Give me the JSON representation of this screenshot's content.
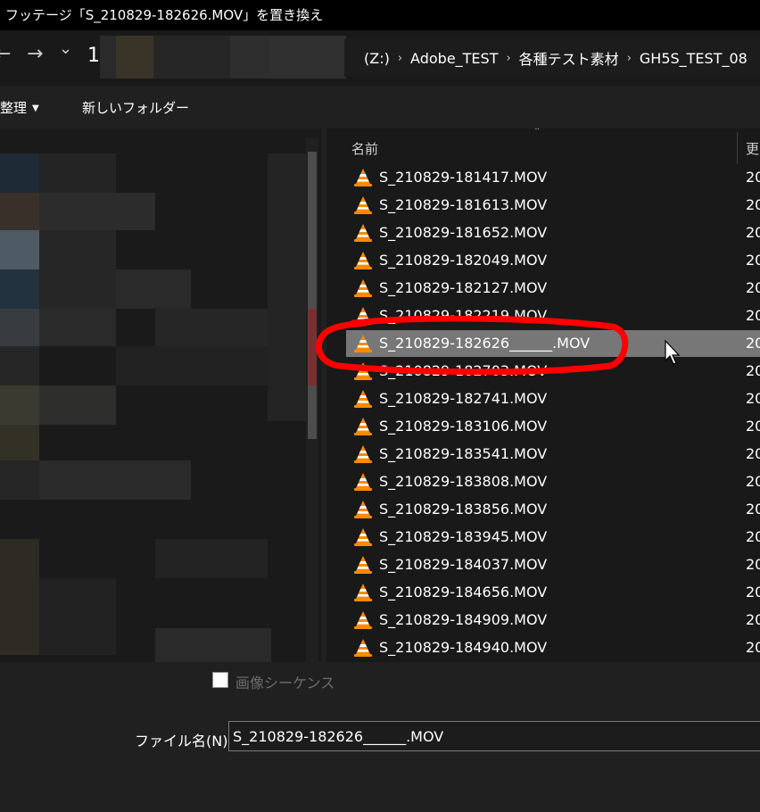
{
  "window": {
    "title": "フッテージ「S_210829-182626.MOV」を置き換え"
  },
  "nav": {
    "back_glyph": "←",
    "forward_glyph": "→",
    "dropdown_glyph": "⌄",
    "partial_text": "1"
  },
  "address": {
    "crumbs": [
      "(Z:)",
      "Adobe_TEST",
      "各種テスト素材",
      "GH5S_TEST_08"
    ],
    "separator": "›"
  },
  "toolbar": {
    "organize_label": "整理",
    "new_folder_label": "新しいフォルダー"
  },
  "file_list": {
    "name_header": "名前",
    "date_header": "更",
    "files": [
      {
        "name": "S_210829-181417.MOV",
        "date": "20"
      },
      {
        "name": "S_210829-181613.MOV",
        "date": "20"
      },
      {
        "name": "S_210829-181652.MOV",
        "date": "20"
      },
      {
        "name": "S_210829-182049.MOV",
        "date": "20"
      },
      {
        "name": "S_210829-182127.MOV",
        "date": "20"
      },
      {
        "name": "S_210829-182219.MOV",
        "date": "20"
      },
      {
        "name": "S_210829-182626______.MOV",
        "date": "20",
        "selected": true
      },
      {
        "name": "S_210829-182703.MOV",
        "date": "20"
      },
      {
        "name": "S_210829-182741.MOV",
        "date": "20"
      },
      {
        "name": "S_210829-183106.MOV",
        "date": "20"
      },
      {
        "name": "S_210829-183541.MOV",
        "date": "20"
      },
      {
        "name": "S_210829-183808.MOV",
        "date": "20"
      },
      {
        "name": "S_210829-183856.MOV",
        "date": "20"
      },
      {
        "name": "S_210829-183945.MOV",
        "date": "20"
      },
      {
        "name": "S_210829-184037.MOV",
        "date": "20"
      },
      {
        "name": "S_210829-184656.MOV",
        "date": "20"
      },
      {
        "name": "S_210829-184909.MOV",
        "date": "20"
      },
      {
        "name": "S_210829-184940.MOV",
        "date": "20"
      }
    ]
  },
  "options": {
    "image_sequence_label": "画像シーケンス",
    "image_sequence_checked": false
  },
  "filename": {
    "label": "ファイル名(N):",
    "value": "S_210829-182626______.MOV"
  },
  "colors": {
    "background": "#202020",
    "selection": "#777777",
    "annotation_red": "#ff0000",
    "vlc_orange": "#ff8a00"
  },
  "icons": {
    "file_icon": "vlc-cone-icon",
    "cursor": "mouse-pointer-icon"
  }
}
